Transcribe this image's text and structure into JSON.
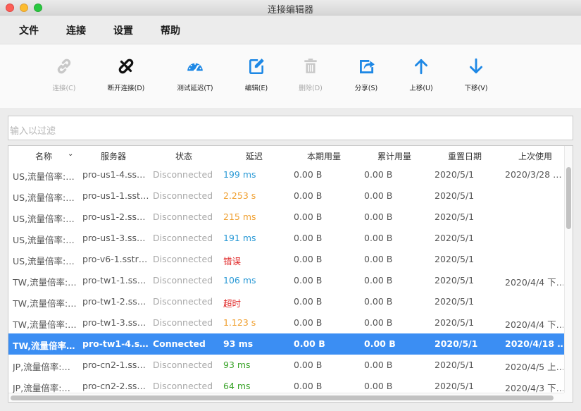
{
  "window": {
    "title": "连接编辑器"
  },
  "menu": [
    "文件",
    "连接",
    "设置",
    "帮助"
  ],
  "toolbar": [
    {
      "label": "连接(C)",
      "icon": "link-icon",
      "enabled": false
    },
    {
      "label": "断开连接(D)",
      "icon": "unlink-icon",
      "enabled": true
    },
    {
      "label": "测试延迟(T)",
      "icon": "speedometer-icon",
      "enabled": true
    },
    {
      "label": "编辑(E)",
      "icon": "edit-icon",
      "enabled": true
    },
    {
      "label": "删除(D)",
      "icon": "trash-icon",
      "enabled": false
    },
    {
      "label": "分享(S)",
      "icon": "share-icon",
      "enabled": true
    },
    {
      "label": "上移(U)",
      "icon": "arrow-up-icon",
      "enabled": true
    },
    {
      "label": "下移(V)",
      "icon": "arrow-down-icon",
      "enabled": true
    }
  ],
  "search": {
    "placeholder": "输入以过滤"
  },
  "colors": {
    "accent": "#3b8ef3",
    "latency_ok": "#2b9ad6",
    "latency_slow": "#f0a030",
    "error": "#e02a2a",
    "good": "#3aa42a",
    "disabled": "#a8a8a8"
  },
  "table": {
    "columns": [
      "名称",
      "服务器",
      "状态",
      "延迟",
      "本期用量",
      "累计用量",
      "重置日期",
      "上次使用"
    ],
    "rows": [
      {
        "name": "US,流量倍率:…",
        "server": "pro-us1-4.ss…",
        "status": "Disconnected",
        "latency": "199 ms",
        "latency_color": "#2b9ad6",
        "period": "0.00  B",
        "total": "0.00  B",
        "reset": "2020/5/1",
        "last": "2020/3/28 …",
        "selected": false
      },
      {
        "name": "US,流量倍率:…",
        "server": "pro-us1-1.sst…",
        "status": "Disconnected",
        "latency": "2.253 s",
        "latency_color": "#f0a030",
        "period": "0.00  B",
        "total": "0.00  B",
        "reset": "2020/5/1",
        "last": "",
        "selected": false
      },
      {
        "name": "US,流量倍率:…",
        "server": "pro-us1-2.ss…",
        "status": "Disconnected",
        "latency": "215 ms",
        "latency_color": "#f0a030",
        "period": "0.00  B",
        "total": "0.00  B",
        "reset": "2020/5/1",
        "last": "",
        "selected": false
      },
      {
        "name": "US,流量倍率:…",
        "server": "pro-us1-3.ss…",
        "status": "Disconnected",
        "latency": "191 ms",
        "latency_color": "#2b9ad6",
        "period": "0.00  B",
        "total": "0.00  B",
        "reset": "2020/5/1",
        "last": "",
        "selected": false
      },
      {
        "name": "US,流量倍率:…",
        "server": "pro-v6-1.sstr…",
        "status": "Disconnected",
        "latency": "错误",
        "latency_color": "#e02a2a",
        "period": "0.00  B",
        "total": "0.00  B",
        "reset": "2020/5/1",
        "last": "",
        "selected": false
      },
      {
        "name": "TW,流量倍率:…",
        "server": "pro-tw1-1.ss…",
        "status": "Disconnected",
        "latency": "106 ms",
        "latency_color": "#2b9ad6",
        "period": "0.00  B",
        "total": "0.00  B",
        "reset": "2020/5/1",
        "last": "2020/4/4 下…",
        "selected": false
      },
      {
        "name": "TW,流量倍率:…",
        "server": "pro-tw1-2.ss…",
        "status": "Disconnected",
        "latency": "超时",
        "latency_color": "#e02a2a",
        "period": "0.00  B",
        "total": "0.00  B",
        "reset": "2020/5/1",
        "last": "",
        "selected": false
      },
      {
        "name": "TW,流量倍率:…",
        "server": "pro-tw1-3.ss…",
        "status": "Disconnected",
        "latency": "1.123 s",
        "latency_color": "#f0a030",
        "period": "0.00  B",
        "total": "0.00  B",
        "reset": "2020/5/1",
        "last": "2020/4/4 下…",
        "selected": false
      },
      {
        "name": "TW,流量倍率…",
        "server": "pro-tw1-4.s…",
        "status": "Connected",
        "latency": "93 ms",
        "latency_color": "#ffffff",
        "period": "0.00  B",
        "total": "0.00  B",
        "reset": "2020/5/1",
        "last": "2020/4/18 …",
        "selected": true
      },
      {
        "name": "JP,流量倍率:…",
        "server": "pro-cn2-1.ss…",
        "status": "Disconnected",
        "latency": "93 ms",
        "latency_color": "#3aa42a",
        "period": "0.00  B",
        "total": "0.00  B",
        "reset": "2020/5/1",
        "last": "2020/4/5 上…",
        "selected": false
      },
      {
        "name": "JP,流量倍率:…",
        "server": "pro-cn2-2.ss…",
        "status": "Disconnected",
        "latency": "64 ms",
        "latency_color": "#3aa42a",
        "period": "0.00  B",
        "total": "0.00  B",
        "reset": "2020/5/1",
        "last": "2020/4/3 下…",
        "selected": false
      }
    ]
  }
}
